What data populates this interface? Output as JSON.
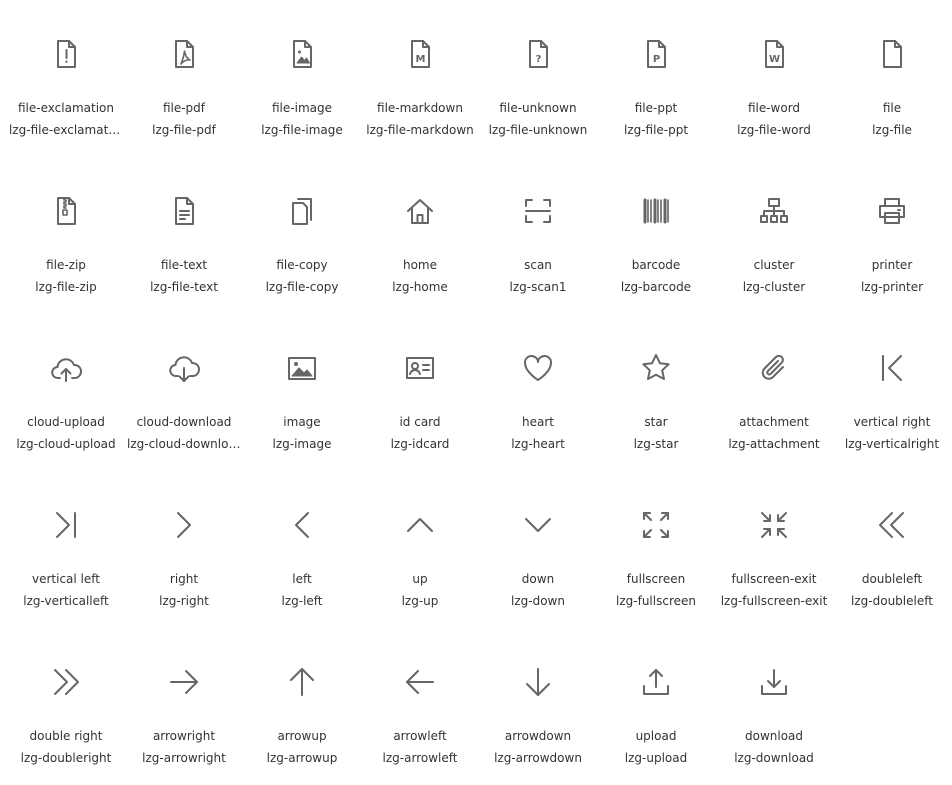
{
  "icons": [
    {
      "name": "file-exclamation",
      "class": "lzg-file-exclamation",
      "icon": "file-exclamation-icon"
    },
    {
      "name": "file-pdf",
      "class": "lzg-file-pdf",
      "icon": "file-pdf-icon"
    },
    {
      "name": "file-image",
      "class": "lzg-file-image",
      "icon": "file-image-icon"
    },
    {
      "name": "file-markdown",
      "class": "lzg-file-markdown",
      "icon": "file-markdown-icon",
      "glyph": "M"
    },
    {
      "name": "file-unknown",
      "class": "lzg-file-unknown",
      "icon": "file-unknown-icon",
      "glyph": "?"
    },
    {
      "name": "file-ppt",
      "class": "lzg-file-ppt",
      "icon": "file-ppt-icon",
      "glyph": "P"
    },
    {
      "name": "file-word",
      "class": "lzg-file-word",
      "icon": "file-word-icon",
      "glyph": "W"
    },
    {
      "name": "file",
      "class": "lzg-file",
      "icon": "file-icon"
    },
    {
      "name": "file-zip",
      "class": "lzg-file-zip",
      "icon": "file-zip-icon"
    },
    {
      "name": "file-text",
      "class": "lzg-file-text",
      "icon": "file-text-icon"
    },
    {
      "name": "file-copy",
      "class": "lzg-file-copy",
      "icon": "file-copy-icon"
    },
    {
      "name": "home",
      "class": "lzg-home",
      "icon": "home-icon"
    },
    {
      "name": "scan",
      "class": "lzg-scan1",
      "icon": "scan-icon"
    },
    {
      "name": "barcode",
      "class": "lzg-barcode",
      "icon": "barcode-icon"
    },
    {
      "name": "cluster",
      "class": "lzg-cluster",
      "icon": "cluster-icon"
    },
    {
      "name": "printer",
      "class": "lzg-printer",
      "icon": "printer-icon"
    },
    {
      "name": "cloud-upload",
      "class": "lzg-cloud-upload",
      "icon": "cloud-upload-icon"
    },
    {
      "name": "cloud-download",
      "class": "lzg-cloud-download",
      "icon": "cloud-download-icon"
    },
    {
      "name": "image",
      "class": "lzg-image",
      "icon": "image-icon"
    },
    {
      "name": "id card",
      "class": "lzg-idcard",
      "icon": "id-card-icon"
    },
    {
      "name": "heart",
      "class": "lzg-heart",
      "icon": "heart-icon"
    },
    {
      "name": "star",
      "class": "lzg-star",
      "icon": "star-icon"
    },
    {
      "name": "attachment",
      "class": "lzg-attachment",
      "icon": "attachment-icon"
    },
    {
      "name": "vertical right",
      "class": "lzg-verticalright",
      "icon": "vertical-right-icon"
    },
    {
      "name": "vertical left",
      "class": "lzg-verticalleft",
      "icon": "vertical-left-icon"
    },
    {
      "name": "right",
      "class": "lzg-right",
      "icon": "chevron-right-icon"
    },
    {
      "name": "left",
      "class": "lzg-left",
      "icon": "chevron-left-icon"
    },
    {
      "name": "up",
      "class": "lzg-up",
      "icon": "chevron-up-icon"
    },
    {
      "name": "down",
      "class": "lzg-down",
      "icon": "chevron-down-icon"
    },
    {
      "name": "fullscreen",
      "class": "lzg-fullscreen",
      "icon": "fullscreen-icon"
    },
    {
      "name": "fullscreen-exit",
      "class": "lzg-fullscreen-exit",
      "icon": "fullscreen-exit-icon"
    },
    {
      "name": "doubleleft",
      "class": "lzg-doubleleft",
      "icon": "double-left-icon"
    },
    {
      "name": "double right",
      "class": "lzg-doubleright",
      "icon": "double-right-icon"
    },
    {
      "name": "arrowright",
      "class": "lzg-arrowright",
      "icon": "arrow-right-icon"
    },
    {
      "name": "arrowup",
      "class": "lzg-arrowup",
      "icon": "arrow-up-icon"
    },
    {
      "name": "arrowleft",
      "class": "lzg-arrowleft",
      "icon": "arrow-left-icon"
    },
    {
      "name": "arrowdown",
      "class": "lzg-arrowdown",
      "icon": "arrow-down-icon"
    },
    {
      "name": "upload",
      "class": "lzg-upload",
      "icon": "upload-icon"
    },
    {
      "name": "download",
      "class": "lzg-download",
      "icon": "download-icon"
    }
  ],
  "colors": {
    "icon": "#666666",
    "text": "#333333",
    "background": "#ffffff"
  }
}
